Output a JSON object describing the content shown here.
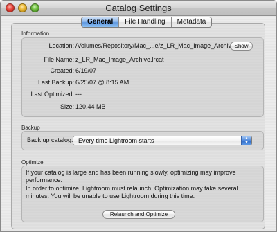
{
  "window": {
    "title": "Catalog Settings"
  },
  "tabs": [
    {
      "label": "General",
      "active": true
    },
    {
      "label": "File Handling",
      "active": false
    },
    {
      "label": "Metadata",
      "active": false
    }
  ],
  "information": {
    "section_label": "Information",
    "rows": [
      {
        "label": "Location:",
        "value": "/Volumes/Repository/Mac_...e/z_LR_Mac_Image_Archive"
      },
      {
        "label": "File Name:",
        "value": "z_LR_Mac_Image_Archive.lrcat"
      },
      {
        "label": "Created:",
        "value": "6/19/07"
      },
      {
        "label": "Last Backup:",
        "value": "6/25/07 @ 8:15 AM"
      },
      {
        "label": "Last Optimized:",
        "value": "---"
      },
      {
        "label": "Size:",
        "value": "120.44 MB"
      }
    ],
    "show_button": "Show"
  },
  "backup": {
    "section_label": "Backup",
    "label": "Back up catalog:",
    "selected": "Every time Lightroom starts"
  },
  "optimize": {
    "section_label": "Optimize",
    "paragraph1": "If your catalog is large and has been running slowly, optimizing may improve performance.",
    "paragraph2": "In order to optimize, Lightroom must relaunch. Optimization may take several minutes. You will be unable to use Lightroom during this time.",
    "button": "Relaunch and Optimize"
  }
}
